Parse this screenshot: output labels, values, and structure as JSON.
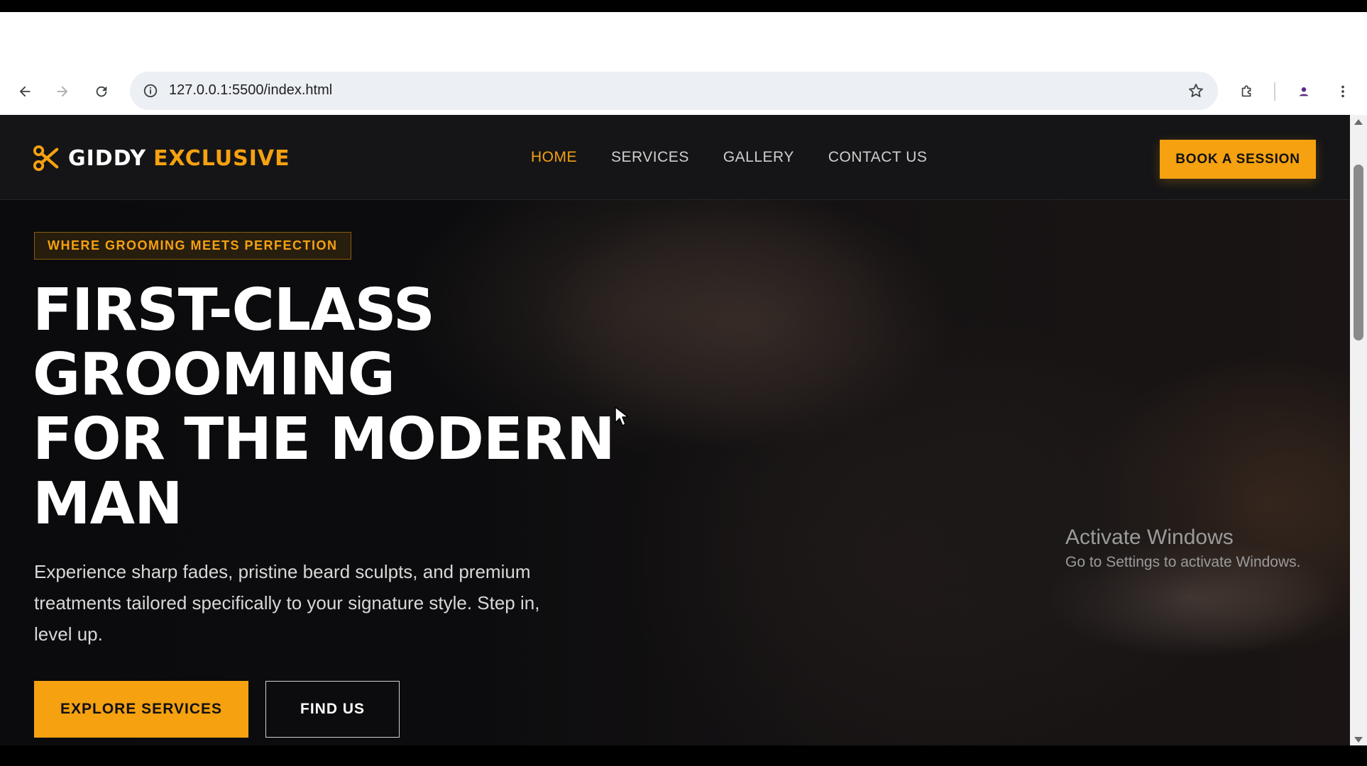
{
  "browser": {
    "url": "127.0.0.1:5500/index.html",
    "icons": {
      "back": "back-arrow-icon",
      "forward": "forward-arrow-icon",
      "reload": "reload-icon",
      "info": "site-info-icon",
      "bookmark": "star-icon",
      "extensions": "puzzle-icon",
      "profile": "profile-icon",
      "menu": "kebab-menu-icon"
    }
  },
  "site": {
    "logo": {
      "part1": "GIDDY",
      "part2": "EXCLUSIVE",
      "icon": "scissors-icon"
    },
    "nav": [
      {
        "label": "HOME",
        "active": true
      },
      {
        "label": "SERVICES",
        "active": false
      },
      {
        "label": "GALLERY",
        "active": false
      },
      {
        "label": "CONTACT US",
        "active": false
      }
    ],
    "book_button": "BOOK A SESSION",
    "colors": {
      "accent": "#f5a110",
      "header_bg": "#151517",
      "hero_bg": "#0b0b0d"
    }
  },
  "hero": {
    "tag": "WHERE GROOMING MEETS PERFECTION",
    "headline": [
      "FIRST-CLASS",
      "GROOMING",
      "FOR THE MODERN",
      "MAN"
    ],
    "description": "Experience sharp fades, pristine beard sculpts, and premium treatments tailored specifically to your signature style. Step in, level up.",
    "primary_button": "EXPLORE SERVICES",
    "secondary_button": "FIND US"
  },
  "watermark": {
    "title": "Activate Windows",
    "subtitle": "Go to Settings to activate Windows."
  }
}
